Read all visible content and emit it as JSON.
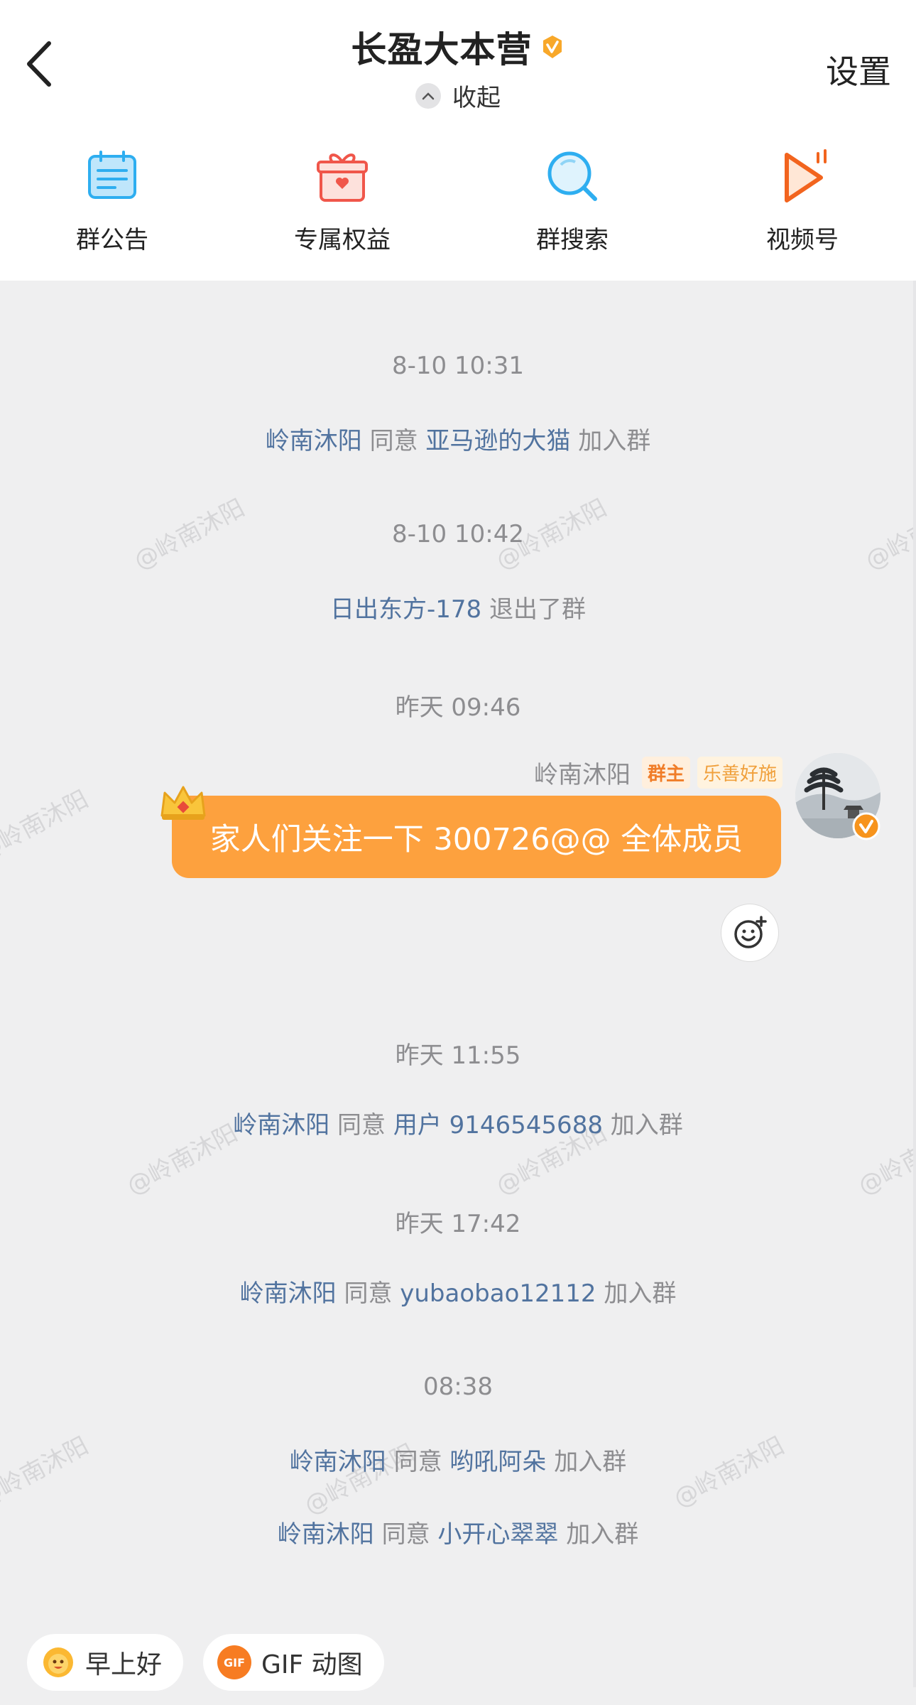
{
  "header": {
    "title": "长盈大本营",
    "collapse_label": "收起",
    "settings_label": "设置",
    "quick_actions": [
      {
        "label": "群公告",
        "icon": "notice-icon"
      },
      {
        "label": "专属权益",
        "icon": "gift-icon"
      },
      {
        "label": "群搜索",
        "icon": "search-icon"
      },
      {
        "label": "视频号",
        "icon": "video-icon"
      }
    ]
  },
  "watermark_text": "@岭南沐阳",
  "chat": {
    "t1": "8-10 10:31",
    "e1": {
      "actor": "岭南沐阳",
      "verb": "同意",
      "target": "亚马逊的大猫",
      "tail": "加入群"
    },
    "t2": "8-10 10:42",
    "e2": {
      "target": "日出东方-178",
      "tail": "退出了群"
    },
    "t3": "昨天 09:46",
    "message": {
      "sender": "岭南沐阳",
      "tag_owner": "群主",
      "tag_fan": "乐善好施",
      "text": "家人们关注一下 300726@@ 全体成员"
    },
    "t4": "昨天 11:55",
    "e3": {
      "actor": "岭南沐阳",
      "verb": "同意",
      "target": "用户 9146545688",
      "tail": "加入群"
    },
    "t5": "昨天 17:42",
    "e4": {
      "actor": "岭南沐阳",
      "verb": "同意",
      "target": "yubaobao12112",
      "tail": "加入群"
    },
    "t6": "08:38",
    "e5": {
      "actor": "岭南沐阳",
      "verb": "同意",
      "target": "哟吼阿朵",
      "tail": "加入群"
    },
    "e6": {
      "actor": "岭南沐阳",
      "verb": "同意",
      "target": "小开心翠翠",
      "tail": "加入群"
    }
  },
  "chips": [
    {
      "label": "早上好"
    },
    {
      "label": "GIF 动图",
      "badge": "GIF"
    }
  ],
  "colors": {
    "link": "#51739f",
    "bubble": "#fda13e",
    "owner_tag": "#f07d28"
  }
}
